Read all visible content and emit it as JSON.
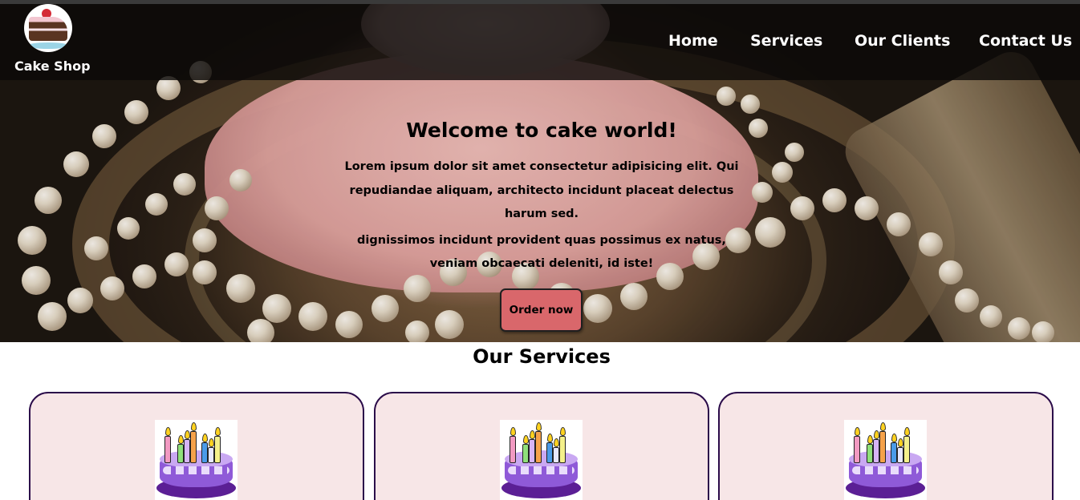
{
  "brand": {
    "name": "Cake Shop",
    "logo_icon": "cake-slice-logo-icon"
  },
  "nav": {
    "items": [
      {
        "label": "Home"
      },
      {
        "label": "Services"
      },
      {
        "label": "Our Clients"
      },
      {
        "label": "Contact Us"
      }
    ]
  },
  "hero": {
    "title": "Welcome to cake world!",
    "paragraph_1": "Lorem ipsum dolor sit amet consectetur adipisicing elit. Qui repudiandae aliquam, architecto incidunt placeat delectus harum sed.",
    "paragraph_2": "dignissimos incidunt provident quas possimus ex natus, veniam obcaecati deleniti, id iste!",
    "cta_label": "Order now",
    "background_image": "pink-cake-with-pearls-photo"
  },
  "services": {
    "title": "Our Services",
    "cards": [
      {
        "image": "birthday-cake-icon"
      },
      {
        "image": "birthday-cake-icon"
      },
      {
        "image": "birthday-cake-icon"
      }
    ]
  },
  "colors": {
    "nav_bg": "#0c0a09",
    "button_bg": "#d9676b",
    "card_bg": "#f7e6e7",
    "card_border": "#2b0c4a"
  }
}
